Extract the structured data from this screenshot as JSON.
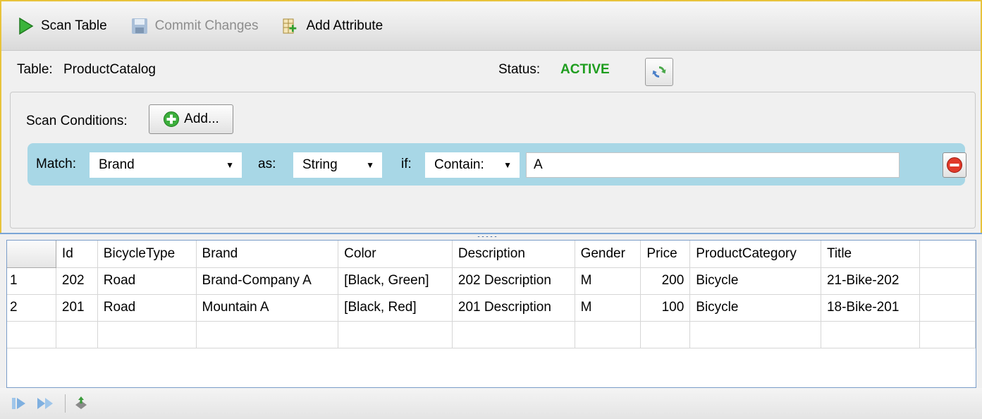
{
  "toolbar": {
    "scan_label": "Scan Table",
    "commit_label": "Commit Changes",
    "add_attr_label": "Add Attribute"
  },
  "info": {
    "table_label": "Table:",
    "table_name": "ProductCatalog",
    "status_label": "Status:",
    "status_value": "ACTIVE"
  },
  "conditions": {
    "label": "Scan Conditions:",
    "add_label": "Add...",
    "row": {
      "match_label": "Match:",
      "attribute": "Brand",
      "as_label": "as:",
      "type": "String",
      "if_label": "if:",
      "operator": "Contain:",
      "value": "A"
    }
  },
  "grid": {
    "columns": [
      "Id",
      "BicycleType",
      "Brand",
      "Color",
      "Description",
      "Gender",
      "Price",
      "ProductCategory",
      "Title"
    ],
    "rows": [
      {
        "num": "1",
        "cells": [
          "202",
          "Road",
          "Brand-Company A",
          "[Black, Green]",
          "202 Description",
          "M",
          "200",
          "Bicycle",
          "21-Bike-202"
        ]
      },
      {
        "num": "2",
        "cells": [
          "201",
          "Road",
          "Mountain A",
          "[Black, Red]",
          "201 Description",
          "M",
          "100",
          "Bicycle",
          "18-Bike-201"
        ]
      }
    ]
  },
  "colors": {
    "status_active": "#1e9d1e",
    "condition_row_bg": "#a8d7e6",
    "panel_border": "#e8c33b"
  }
}
